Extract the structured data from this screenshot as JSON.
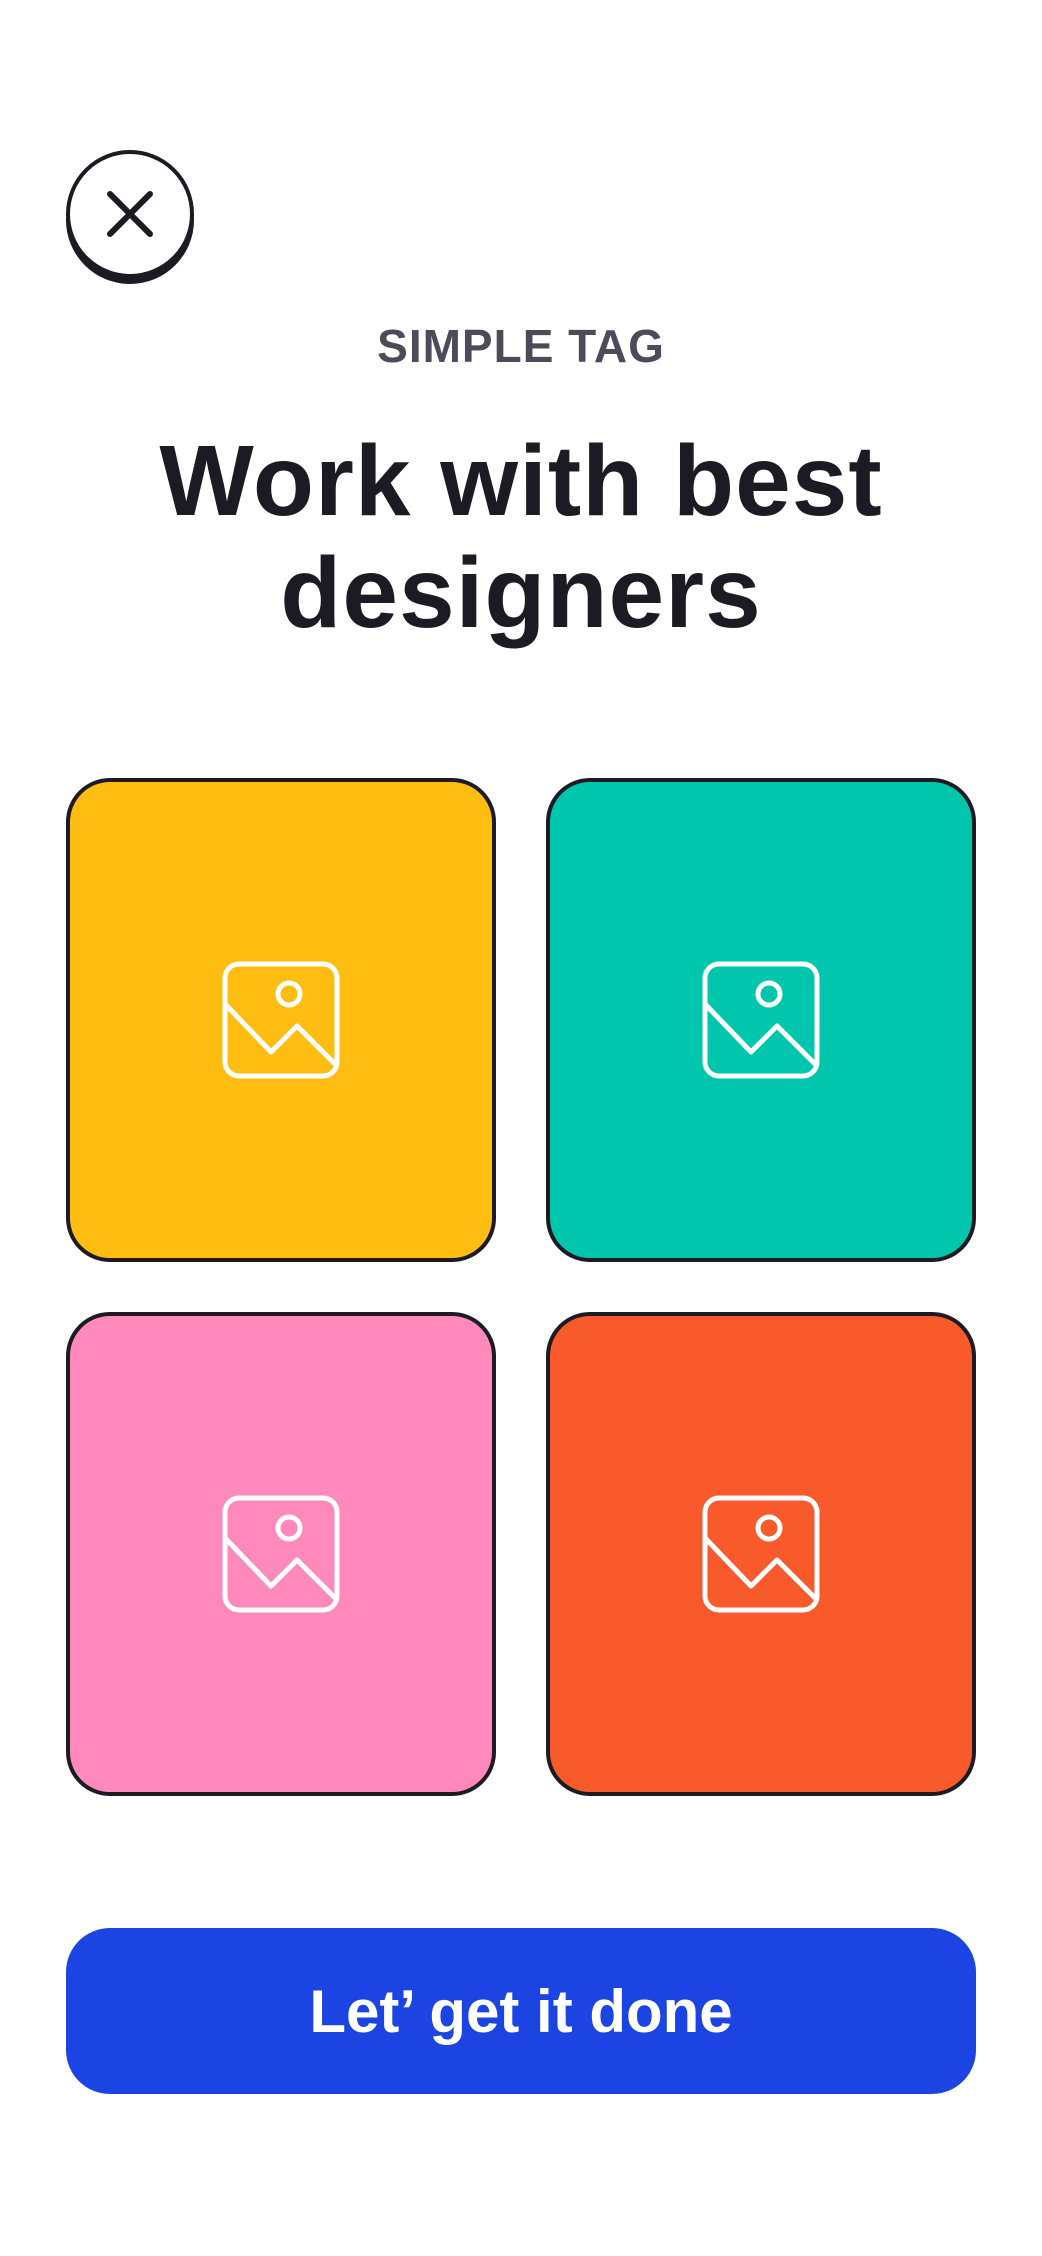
{
  "header": {
    "close_icon": "close-icon",
    "eyebrow": "SIMPLE TAG",
    "title_line1": "Work with best",
    "title_line2": "designers"
  },
  "tiles": [
    {
      "icon": "image-icon",
      "color": "#FFBD12"
    },
    {
      "icon": "image-icon",
      "color": "#00C6AE"
    },
    {
      "icon": "image-icon",
      "color": "#FF89BB"
    },
    {
      "icon": "image-icon",
      "color": "#F95A2C"
    }
  ],
  "cta": {
    "label": "Let’ get it done",
    "color": "#1B44E2"
  },
  "colors": {
    "ink": "#1C1B23",
    "muted": "#4B4B5A",
    "background": "#FFFFFF"
  }
}
